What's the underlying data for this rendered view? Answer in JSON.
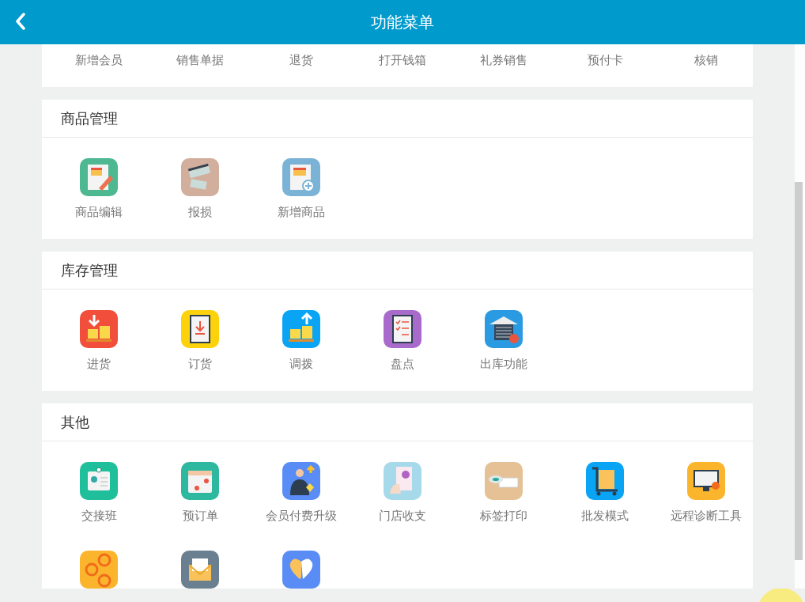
{
  "header": {
    "title": "功能菜单"
  },
  "sections": [
    {
      "items": [
        {
          "label": "新增会员"
        },
        {
          "label": "销售单据"
        },
        {
          "label": "退货"
        },
        {
          "label": "打开钱箱"
        },
        {
          "label": "礼券销售"
        },
        {
          "label": "预付卡"
        },
        {
          "label": "核销"
        }
      ]
    },
    {
      "title": "商品管理",
      "items": [
        {
          "label": "商品编辑",
          "color": "#4db891"
        },
        {
          "label": "报损",
          "color": "#d2ae9d"
        },
        {
          "label": "新增商品",
          "color": "#7ab3d6"
        }
      ]
    },
    {
      "title": "库存管理",
      "items": [
        {
          "label": "进货",
          "color": "#f24e3c"
        },
        {
          "label": "订货",
          "color": "#fbd20c"
        },
        {
          "label": "调拨",
          "color": "#0aa4f5"
        },
        {
          "label": "盘点",
          "color": "#a96bcb"
        },
        {
          "label": "出库功能",
          "color": "#2a9be3"
        }
      ]
    },
    {
      "title": "其他",
      "items": [
        {
          "label": "交接班",
          "color": "#1fbf9b"
        },
        {
          "label": "预订单",
          "color": "#2fb8a0"
        },
        {
          "label": "会员付费升级",
          "color": "#5a8cf5"
        },
        {
          "label": "门店收支",
          "color": "#a6d9ea"
        },
        {
          "label": "标签打印",
          "color": "#e5c195"
        },
        {
          "label": "批发模式",
          "color": "#0aa4f5"
        },
        {
          "label": "远程诊断工具",
          "color": "#fbb52d"
        },
        {
          "color": "#fbb52d"
        },
        {
          "color": "#6a8091"
        },
        {
          "color": "#5a8cf5"
        }
      ]
    }
  ]
}
